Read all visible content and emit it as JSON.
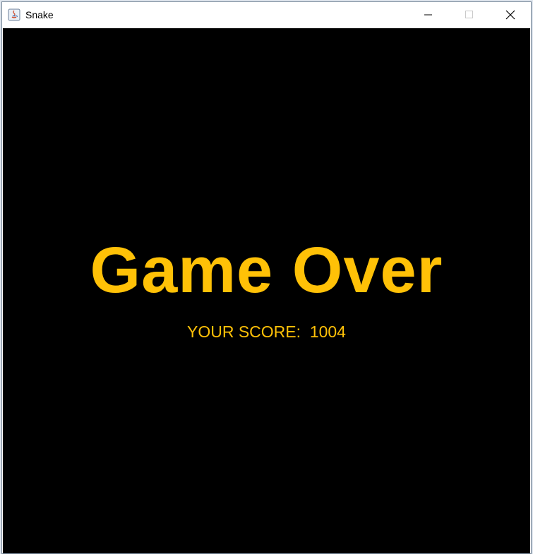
{
  "window": {
    "title": "Snake",
    "app_icon": "java-icon",
    "controls": [
      "minimize-icon",
      "maximize-icon",
      "close-icon"
    ]
  },
  "game": {
    "title": "Game Over",
    "score_label": "YOUR SCORE:",
    "score_value": "1004",
    "colors": {
      "background": "#000000",
      "text": "#FFC107"
    }
  }
}
